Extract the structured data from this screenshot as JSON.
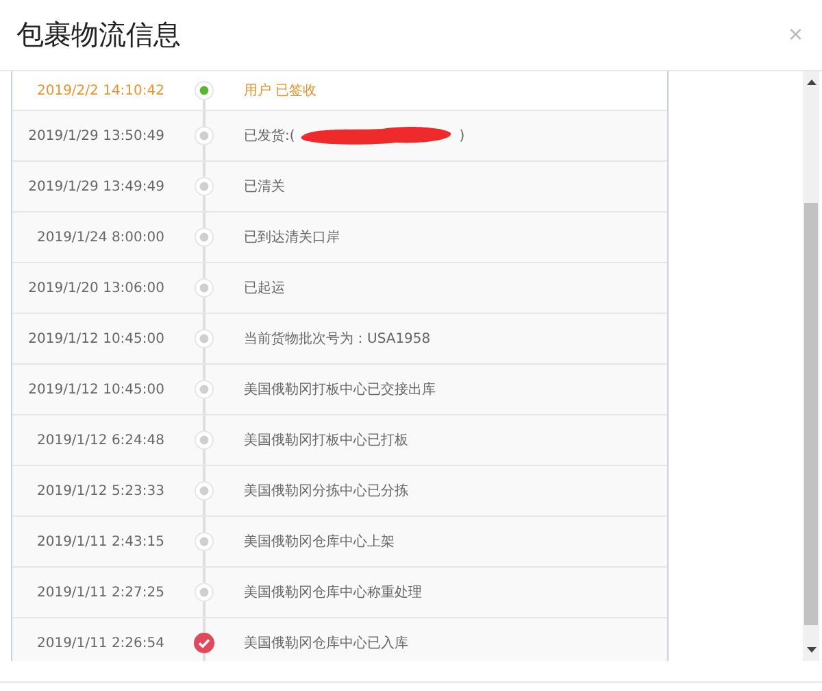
{
  "dialog": {
    "title": "包裹物流信息",
    "close": "×"
  },
  "events": [
    {
      "time": "2019/2/2 14:10:42",
      "status": "用户 已签收",
      "kind": "current"
    },
    {
      "time": "2019/1/29 13:50:49",
      "status": "已发货:(",
      "redacted": true,
      "status_end": ")",
      "kind": "normal"
    },
    {
      "time": "2019/1/29 13:49:49",
      "status": "已清关",
      "kind": "normal"
    },
    {
      "time": "2019/1/24 8:00:00",
      "status": "已到达清关口岸",
      "kind": "normal"
    },
    {
      "time": "2019/1/20 13:06:00",
      "status": "已起运",
      "kind": "normal"
    },
    {
      "time": "2019/1/12 10:45:00",
      "status": "当前货物批次号为：USA1958",
      "kind": "normal"
    },
    {
      "time": "2019/1/12 10:45:00",
      "status": "美国俄勒冈打板中心已交接出库",
      "kind": "normal"
    },
    {
      "time": "2019/1/12 6:24:48",
      "status": "美国俄勒冈打板中心已打板",
      "kind": "normal"
    },
    {
      "time": "2019/1/12 5:23:33",
      "status": "美国俄勒冈分拣中心已分拣",
      "kind": "normal"
    },
    {
      "time": "2019/1/11 2:43:15",
      "status": "美国俄勒冈仓库中心上架",
      "kind": "normal"
    },
    {
      "time": "2019/1/11 2:27:25",
      "status": "美国俄勒冈仓库中心称重处理",
      "kind": "normal"
    },
    {
      "time": "2019/1/11 2:26:54",
      "status": "美国俄勒冈仓库中心已入库",
      "kind": "origin"
    }
  ]
}
